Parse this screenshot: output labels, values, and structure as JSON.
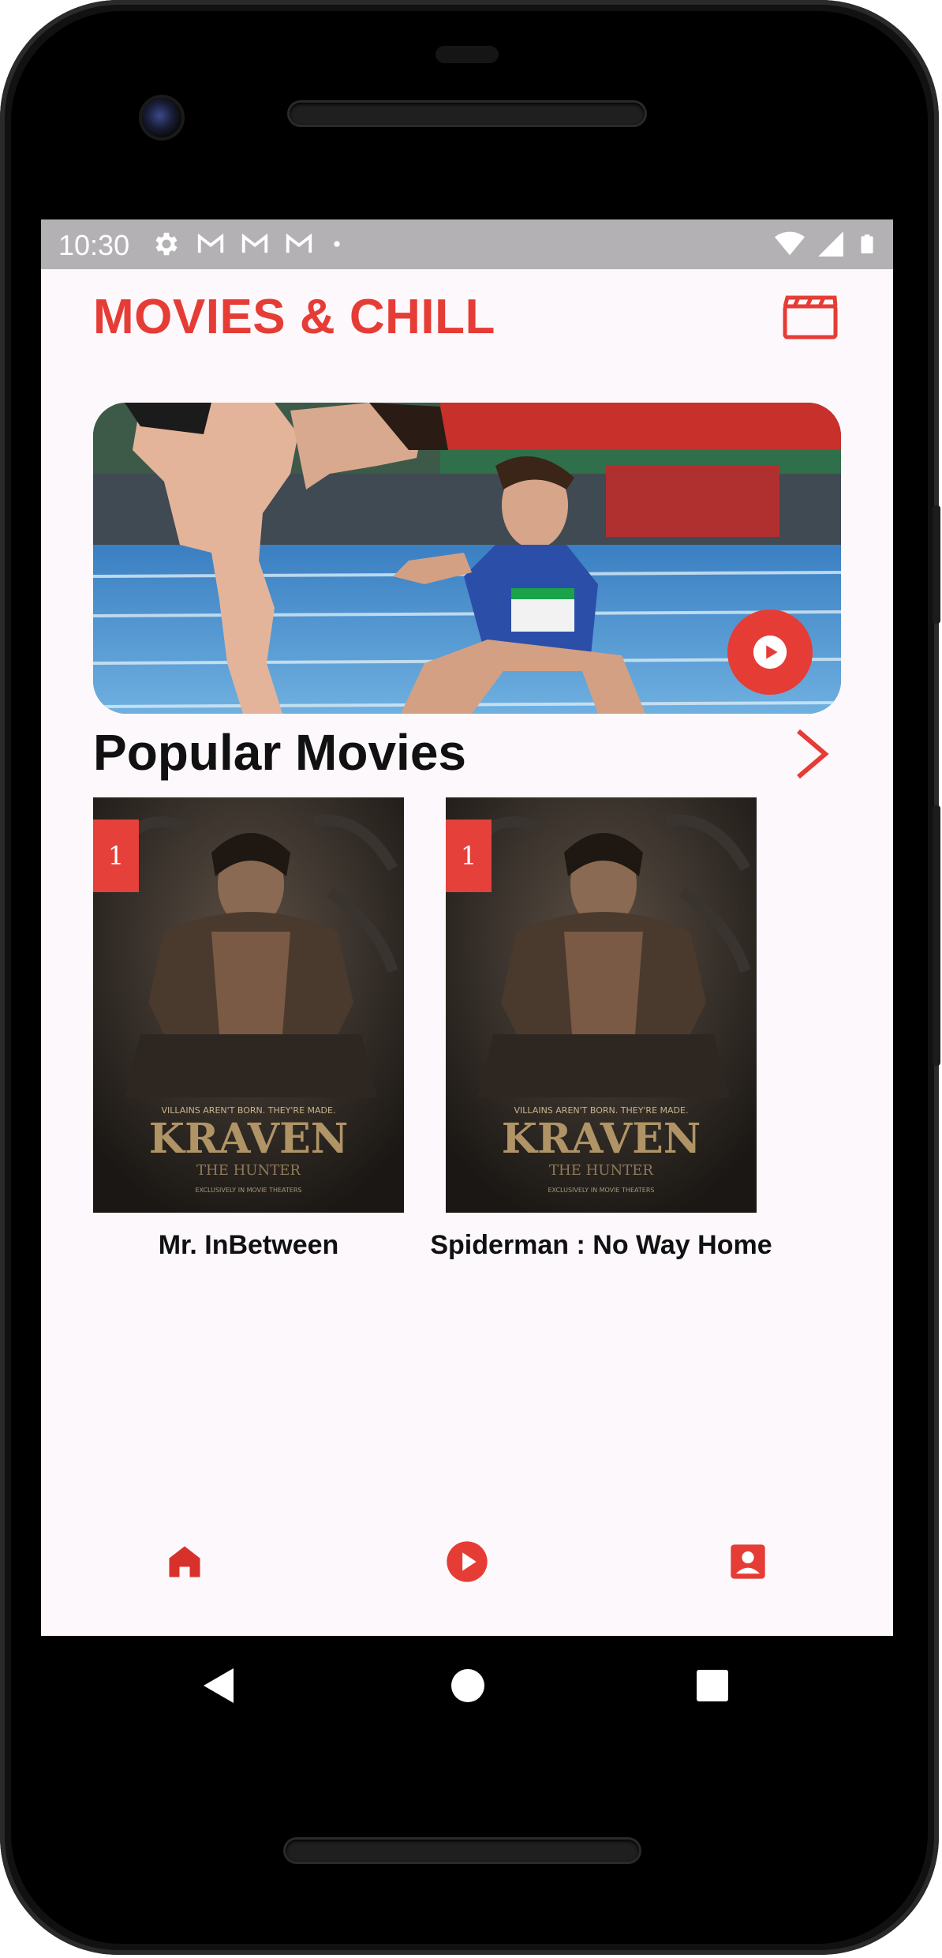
{
  "status_bar": {
    "time": "10:30",
    "left_icons": [
      "gear-icon",
      "gmail-icon",
      "gmail-icon",
      "gmail-icon",
      "dot-icon"
    ],
    "right_icons": [
      "wifi-icon",
      "signal-icon",
      "battery-icon"
    ]
  },
  "app": {
    "title": "MOVIES & CHILL",
    "header_icon": "clapperboard-icon",
    "accent_color": "#e63c36"
  },
  "hero": {
    "play_icon": "play-icon"
  },
  "popular": {
    "section_title": "Popular Movies",
    "see_more_icon": "chevron-right-icon",
    "movies": [
      {
        "rank": "1",
        "title": "Mr. InBetween",
        "poster_text": "VILLAINS AREN'T BORN. THEY'RE MADE.",
        "poster_logo": "KRAVEN",
        "poster_sub": "THE HUNTER",
        "poster_foot": "EXCLUSIVELY IN MOVIE THEATERS"
      },
      {
        "rank": "1",
        "title": "Spiderman : No Way Home",
        "poster_text": "VILLAINS AREN'T BORN. THEY'RE MADE.",
        "poster_logo": "KRAVEN",
        "poster_sub": "THE HUNTER",
        "poster_foot": "EXCLUSIVELY IN MOVIE THEATERS"
      }
    ]
  },
  "bottom_nav": {
    "items": [
      "home-icon",
      "play-circle-icon",
      "profile-icon"
    ]
  },
  "system_nav": [
    "back-icon",
    "home-circle-icon",
    "recents-icon"
  ]
}
